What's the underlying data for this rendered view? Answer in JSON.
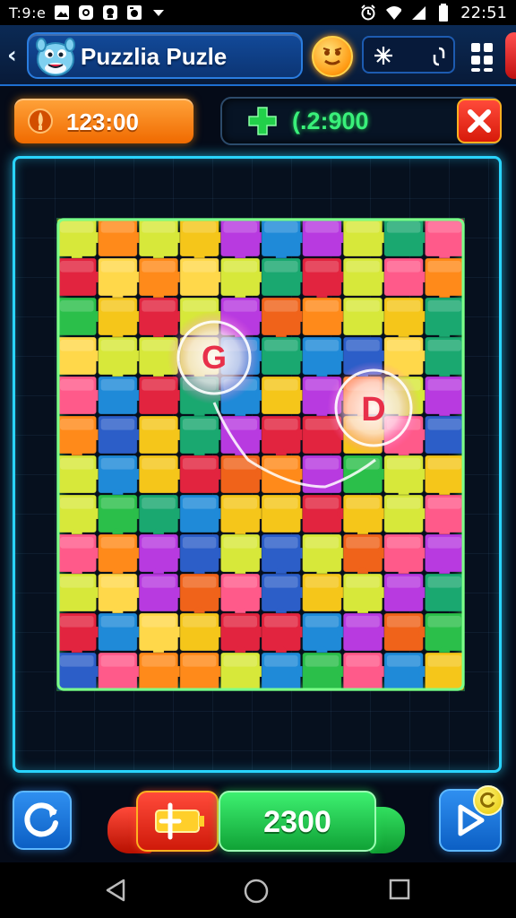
{
  "status_bar": {
    "left_text": "T:9:e",
    "clock": "22:51",
    "icons": [
      "image-icon",
      "instagram-icon",
      "dropbox-icon",
      "photo-icon",
      "download-arrow-icon",
      "alarm-icon",
      "wifi-icon",
      "signal-icon",
      "battery-icon"
    ]
  },
  "header": {
    "title": "Puzzlia Puzle",
    "back_icon": "back-chevron-icon",
    "mascot_icon": "mascot-icon",
    "coin_icon": "coin-face-icon",
    "settings_icons": [
      "snowflake-icon",
      "link-icon"
    ],
    "menu_icon": "grid-menu-icon"
  },
  "top_bar": {
    "timer_value": "123:00",
    "timer_icon": "flame-icon",
    "score_value": "(.2:900",
    "score_icon": "plus-icon",
    "close_icon": "close-x-icon"
  },
  "board": {
    "rows": 12,
    "cols": 10,
    "highlight_letters": [
      "G",
      "D"
    ]
  },
  "bottom_bar": {
    "undo_icon": "refresh-icon",
    "hint_icon": "plus-battery-icon",
    "score_value": "2300",
    "play_icon": "play-icon",
    "badge_icon": "refresh-badge-icon"
  },
  "colors": {
    "accent_cyan": "#29d4ff",
    "accent_green": "#39f07a",
    "accent_orange": "#f06a00",
    "accent_red": "#d71a0a",
    "accent_blue": "#0c5fc4"
  },
  "nav_bar": {
    "icons": [
      "back-triangle-icon",
      "home-circle-icon",
      "recents-square-icon"
    ]
  }
}
